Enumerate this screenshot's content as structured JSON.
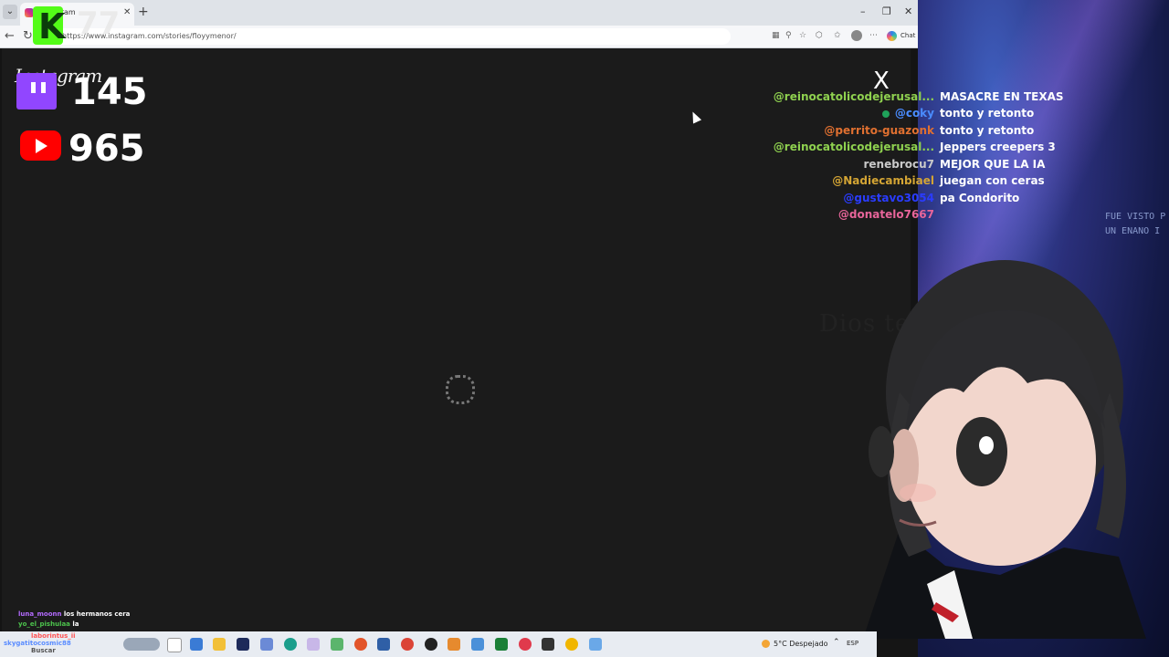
{
  "browser": {
    "tab_title": "Instagram",
    "url": "https://www.instagram.com/stories/floyymenor/",
    "chat_label": "Chat"
  },
  "page": {
    "logo": "Instagram",
    "close_glyph": "X"
  },
  "overlay": {
    "kick_count": "77",
    "twitch_count": "145",
    "youtube_count": "965",
    "side_text_1": "FUE VISTO P",
    "side_text_2": "UN ENANO I",
    "avatar_text": "Dios te"
  },
  "chat": [
    {
      "user": "@reinocatolicodejerusal...",
      "msg": "MASACRE EN TEXAS",
      "color": "#8fd14f"
    },
    {
      "user": "@coky",
      "msg": "tonto y retonto",
      "color": "#4a8cff",
      "badge": true
    },
    {
      "user": "@perrito-guazonk",
      "msg": "tonto y retonto",
      "color": "#e07030"
    },
    {
      "user": "@reinocatolicodejerusal...",
      "msg": "Jeppers creepers 3",
      "color": "#8fd14f"
    },
    {
      "user": "renebrocu7",
      "msg": "MEJOR QUE LA IA",
      "color": "#c9c9c9"
    },
    {
      "user": "@Nadiecambiael",
      "msg": "juegan con ceras",
      "color": "#d4a534"
    },
    {
      "user": "@gustavo3054",
      "msg": "pa Condorito",
      "color": "#2a3cff"
    },
    {
      "user": "@donatelo7667",
      "msg": "",
      "color": "#e8659a"
    }
  ],
  "small_chat": [
    {
      "user": "luna_moonn",
      "msg": "los hermanos cera",
      "color": "#b46bff"
    },
    {
      "user": "yo_el_pishulaa",
      "msg": "la",
      "color": "#4cc24c"
    },
    {
      "user": "laborintus_ii",
      "msg": "",
      "color": "#ff5555"
    },
    {
      "user": "skygatitocosmic88",
      "msg": "",
      "color": "#5a8cff"
    }
  ],
  "taskbar": {
    "search_label": "Buscar",
    "weather": "5°C  Despejado",
    "lang": "ESP"
  }
}
